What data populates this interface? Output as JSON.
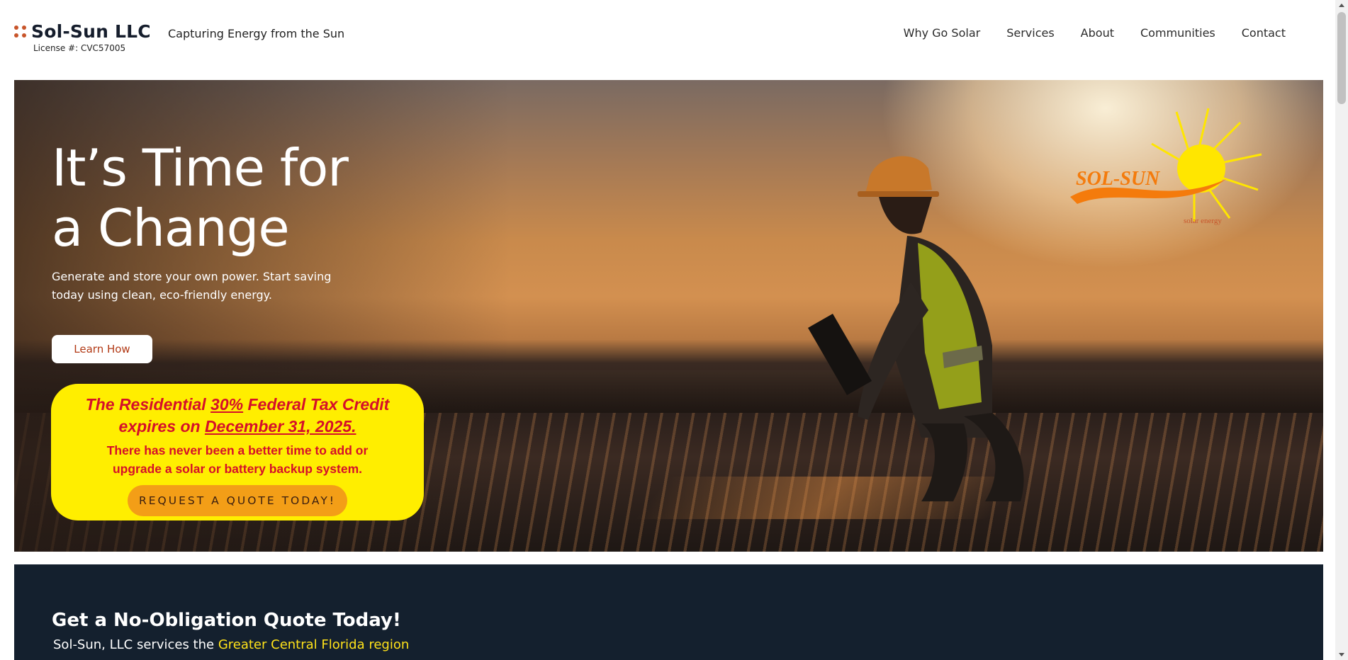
{
  "header": {
    "brand_name": "Sol-Sun LLC",
    "license": "License #: CVC57005",
    "tagline": "Capturing Energy from the Sun",
    "nav": [
      {
        "label": "Why Go Solar"
      },
      {
        "label": "Services"
      },
      {
        "label": "About"
      },
      {
        "label": "Communities"
      },
      {
        "label": "Contact"
      }
    ]
  },
  "hero": {
    "title_line1": "It’s Time for",
    "title_line2": "a Change",
    "subtitle": "Generate and store your own power. Start saving today using clean, eco-friendly energy.",
    "learn_button": "Learn How",
    "promo": {
      "line1_a": "The Residential ",
      "line1_b": "30%",
      "line1_c": " Federal Tax Credit",
      "line2_a": "expires on ",
      "line2_b": "December 31, 2025.",
      "sub_line1": "There has never been a better time to add or",
      "sub_line2": "upgrade a solar or battery backup system.",
      "button": "REQUEST A QUOTE TODAY!"
    },
    "logo": {
      "name": "SOL-SUN",
      "tag": "solar energy"
    }
  },
  "quote_section": {
    "title": "Get a No-Obligation Quote Today!",
    "sub_prefix": "Sol-Sun, LLC services the ",
    "sub_highlight": "Greater Central Florida region"
  },
  "colors": {
    "accent_orange": "#f39e17",
    "promo_yellow": "#ffee00",
    "promo_red": "#d50f2a",
    "dark_navy": "#14202e",
    "highlight_yellow": "#ffe21a"
  }
}
